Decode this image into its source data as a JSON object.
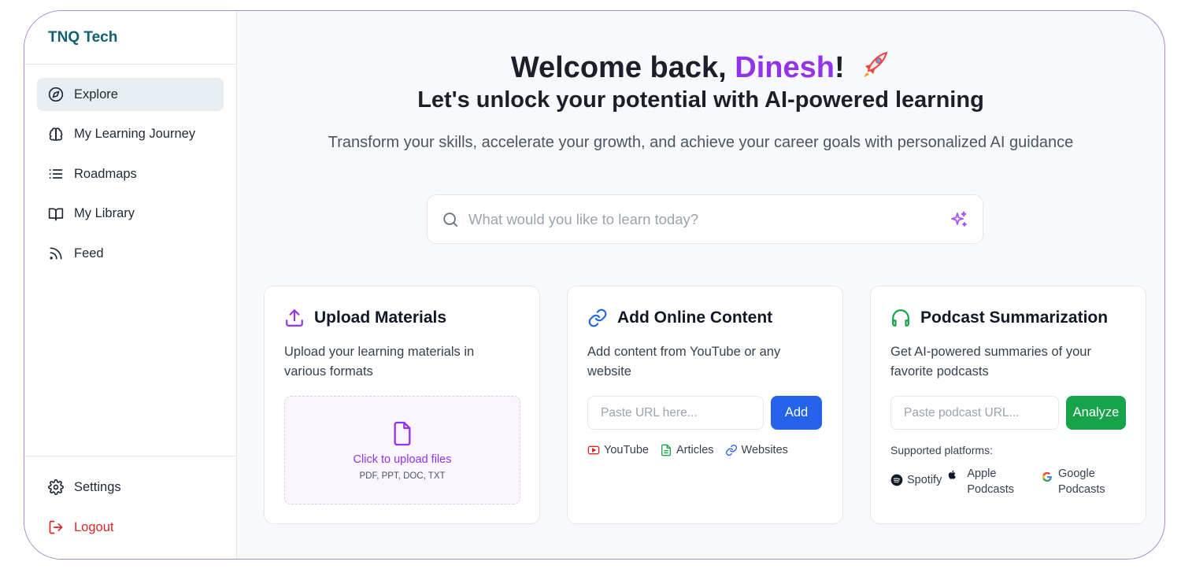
{
  "brand": "TNQ Tech",
  "sidebar": {
    "items": [
      {
        "label": "Explore",
        "icon": "compass-icon",
        "active": true
      },
      {
        "label": "My Learning Journey",
        "icon": "brain-icon"
      },
      {
        "label": "Roadmaps",
        "icon": "list-icon"
      },
      {
        "label": "My Library",
        "icon": "book-open-icon"
      },
      {
        "label": "Feed",
        "icon": "rss-icon"
      }
    ],
    "bottom": [
      {
        "label": "Settings",
        "icon": "gear-icon"
      },
      {
        "label": "Logout",
        "icon": "logout-icon"
      }
    ]
  },
  "hero": {
    "greeting_prefix": "Welcome back, ",
    "user_name": "Dinesh",
    "greeting_suffix": "!",
    "emoji": "🚀",
    "subheading": "Let's unlock your potential with AI-powered learning",
    "tagline": "Transform your skills, accelerate your growth, and achieve your career goals with personalized AI guidance"
  },
  "search": {
    "placeholder": "What would you like to learn today?",
    "value": ""
  },
  "cards": {
    "upload": {
      "title": "Upload Materials",
      "description": "Upload your learning materials in various formats",
      "cta": "Click to upload files",
      "formats": "PDF, PPT, DOC, TXT"
    },
    "online": {
      "title": "Add Online Content",
      "description": "Add content from YouTube or any website",
      "placeholder": "Paste URL here...",
      "button": "Add",
      "sources": [
        "YouTube",
        "Articles",
        "Websites"
      ]
    },
    "podcast": {
      "title": "Podcast Summarization",
      "description": "Get AI-powered summaries of your favorite podcasts",
      "placeholder": "Paste podcast URL...",
      "button": "Analyze",
      "supported_label": "Supported platforms:",
      "platforms": [
        {
          "line1": "Spotify",
          "line2": ""
        },
        {
          "line1": "Apple",
          "line2": "Podcasts"
        },
        {
          "line1": "Google",
          "line2": "Podcasts"
        }
      ]
    }
  },
  "colors": {
    "accent_purple": "#9333ea",
    "brand_teal": "#115e73",
    "add_blue": "#2563eb",
    "analyze_green": "#16a34a",
    "logout_red": "#dc2626"
  }
}
